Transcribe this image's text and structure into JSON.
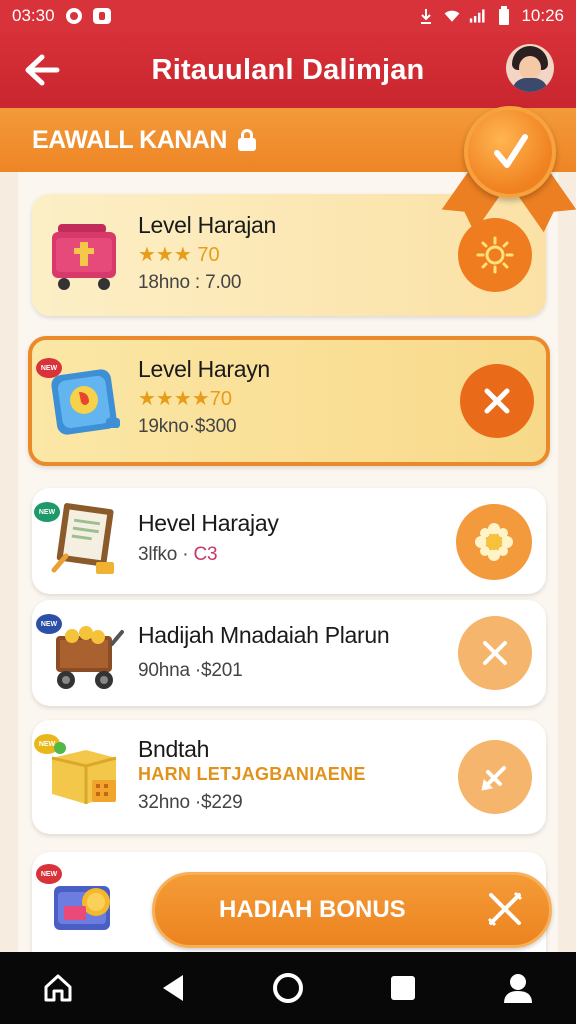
{
  "status_bar": {
    "time": "03:30",
    "clock_right": "10:26",
    "icons": [
      "game-icon",
      "app-icon",
      "download-icon",
      "wifi-icon",
      "signal-icon",
      "battery-icon"
    ]
  },
  "app_bar": {
    "title": "Ritauulanl Dalimjan",
    "back_icon": "arrow-left-icon",
    "avatar": "user-avatar"
  },
  "section": {
    "title": "EAWALL KANAN",
    "icon": "lock-icon"
  },
  "medal": {
    "symbol": "✓",
    "icon": "medal-check-icon"
  },
  "items": [
    {
      "title": "Level Harajan",
      "rating": "★★★ 70",
      "sub": "18hno : 7.00",
      "action_icon": "sun-icon"
    },
    {
      "title": "Level Harayn",
      "rating": "★★★★70",
      "sub": "19kno·$300",
      "badge": "NEW",
      "action_icon": "close-icon"
    },
    {
      "title": "Hevel Harajay",
      "sub": "3lfko ·",
      "sub_highlight": "C3",
      "badge": "NEW",
      "action_icon": "flower-icon"
    },
    {
      "title": "Hadijah Mnadaiah Plarun",
      "sub": "90hna ·$201",
      "badge": "NEW",
      "action_icon": "close-icon"
    },
    {
      "title": "Bndtah",
      "promo": "HARN LETJAGBANIAENE",
      "sub": "32hno ·$229",
      "badge": "NEW",
      "action_icon": "pencil-icon"
    }
  ],
  "bonus_button": {
    "label": "HADIAH BONUS",
    "icon": "cross-icon",
    "badge": "NEW"
  },
  "colors": {
    "primary_red": "#d8323a",
    "accent_orange": "#ef7d1f",
    "gold_card": "#fbe1a5"
  }
}
